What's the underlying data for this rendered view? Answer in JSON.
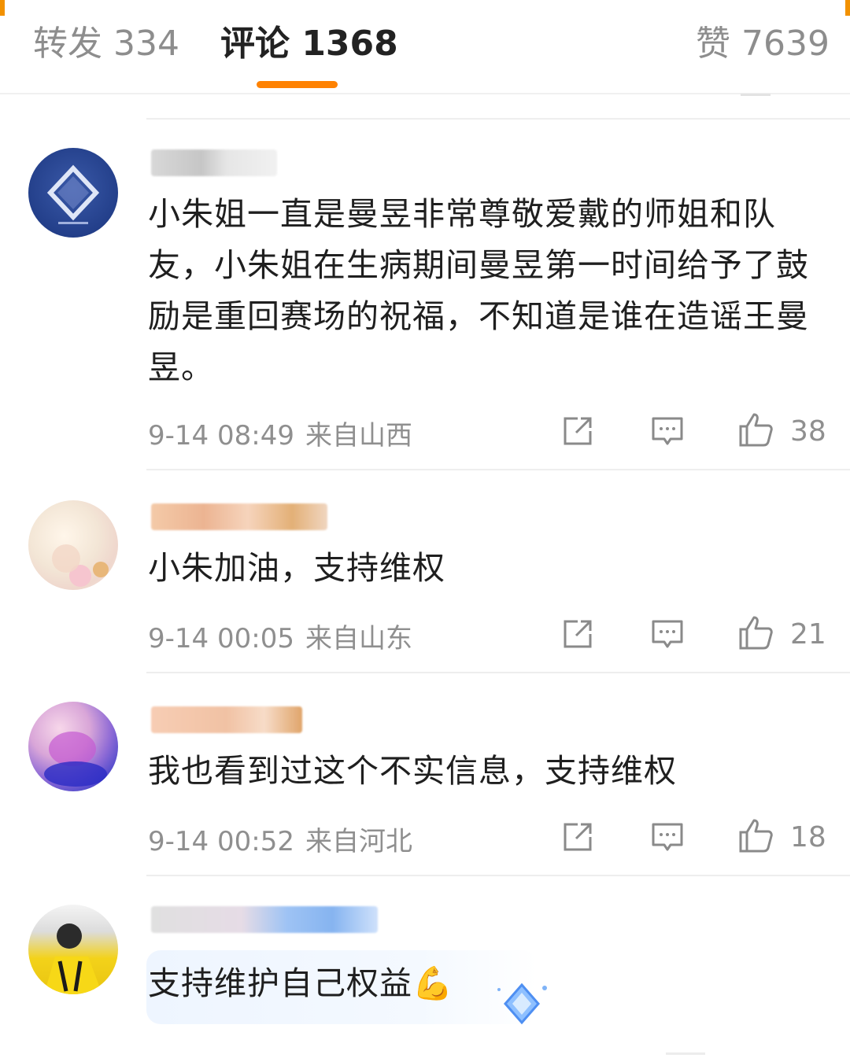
{
  "tabs": [
    {
      "label": "转发 334"
    },
    {
      "label": "评论 1368"
    },
    {
      "label": "赞 7639"
    }
  ],
  "colors": {
    "accent": "#ff8200",
    "meta_text": "#8f8f8f",
    "body_text": "#1f1f1f"
  },
  "comments": [
    {
      "text": "小朱姐一直是曼昱非常尊敬爱戴的师姐和队友，小朱姐在生病期间曼昱第一时间给予了鼓励是重回赛场的祝福，不知道是谁在造谣王曼昱。",
      "time": "9-14 08:49",
      "location": "来自山西",
      "likes": "38"
    },
    {
      "text": "小朱加油，支持维权",
      "time": "9-14 00:05",
      "location": "来自山东",
      "likes": "21"
    },
    {
      "text": "我也看到过这个不实信息，支持维权",
      "time": "9-14 00:52",
      "location": "来自河北",
      "likes": "18"
    },
    {
      "text": "支持维护自己权益💪"
    }
  ],
  "icons": {
    "share": "share-icon",
    "reply": "comment-icon",
    "like": "thumbs-up-icon",
    "badge": "diamond-badge-icon"
  }
}
